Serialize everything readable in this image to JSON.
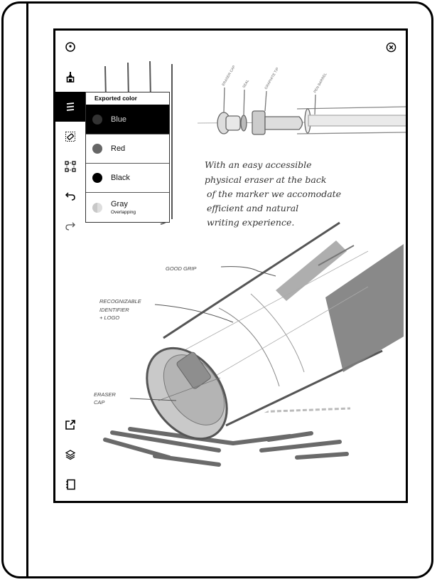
{
  "toolbar": {
    "top": [
      {
        "name": "timer-icon",
        "label": "Focus / tools"
      },
      {
        "name": "pen-icon",
        "label": "Writing tool"
      },
      {
        "name": "color-lines-icon",
        "label": "Stroke color",
        "active": true
      },
      {
        "name": "eraser-select-icon",
        "label": "Eraser selection"
      },
      {
        "name": "selection-tool-icon",
        "label": "Select"
      },
      {
        "name": "undo-icon",
        "label": "Undo"
      },
      {
        "name": "redo-icon",
        "label": "Redo"
      }
    ],
    "bottom": [
      {
        "name": "export-icon",
        "label": "Share / export"
      },
      {
        "name": "layers-icon",
        "label": "Layers"
      },
      {
        "name": "notebook-icon",
        "label": "Notebook"
      }
    ],
    "close": {
      "name": "close-icon",
      "label": "Close"
    }
  },
  "color_menu": {
    "header": "Exported color",
    "items": [
      {
        "label": "Blue",
        "sub": "",
        "swatch": "#333333",
        "selected": true
      },
      {
        "label": "Red",
        "sub": "",
        "swatch": "#666666",
        "selected": false
      },
      {
        "label": "Black",
        "sub": "",
        "swatch": "#000000",
        "selected": false
      },
      {
        "label": "Gray",
        "sub": "Overlapping",
        "swatch": "#bbbbbb",
        "selected": false
      }
    ]
  },
  "sketch": {
    "part_labels": [
      "ERASER CAP",
      "SEAL",
      "GRAPHITE TIP",
      "PEN BARREL"
    ],
    "note": [
      "With an easy accessible",
      "physical eraser at the back",
      "of the marker we accomodate",
      "efficient and natural",
      "writing experience."
    ],
    "annotation_grip": "GOOD GRIP",
    "annotation_identifier": [
      "RECOGNIZABLE",
      "IDENTIFIER",
      "+ LOGO"
    ],
    "annotation_eraser": [
      "ERASER",
      "CAP"
    ]
  },
  "colors": {
    "ink": "#000000",
    "sketch_gray": "#6e6e6e",
    "light_gray": "#bdbdbd",
    "selected_bg": "#000000"
  }
}
